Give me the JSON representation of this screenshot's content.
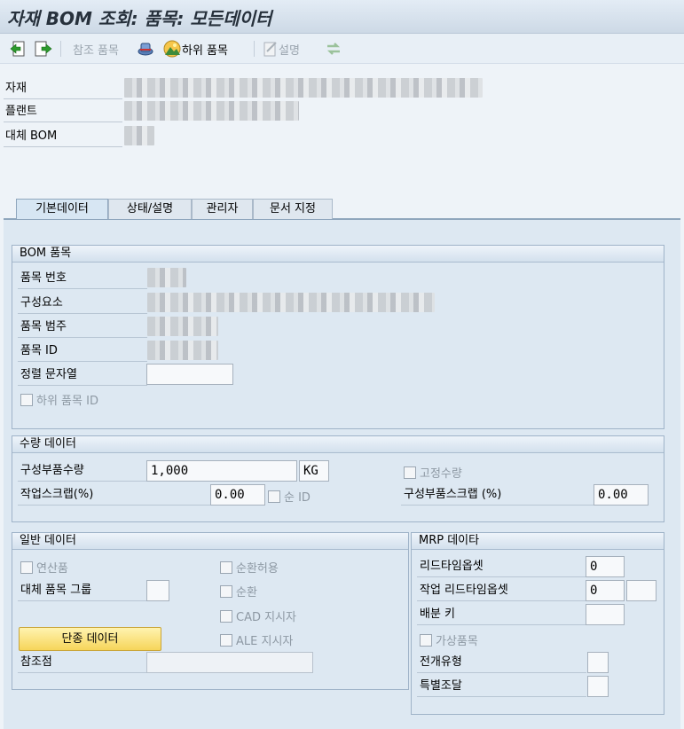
{
  "title": "자재 BOM 조회: 품목: 모든데이터",
  "toolbar": {
    "ref_item": "참조 품목",
    "sub_item": "하위 품목",
    "description": "설명"
  },
  "header": {
    "material_label": "자재",
    "plant_label": "플랜트",
    "alt_bom_label": "대체 BOM"
  },
  "tabs": [
    "기본데이터",
    "상태/설명",
    "관리자",
    "문서 지정"
  ],
  "bom_item": {
    "title": "BOM 품목",
    "item_no_label": "품목 번호",
    "component_label": "구성요소",
    "category_label": "품목 범주",
    "item_id_label": "품목 ID",
    "sort_string_label": "정렬 문자열",
    "sort_string_value": "",
    "sub_item_id_label": "하위 품목 ID"
  },
  "quantity": {
    "title": "수량 데이터",
    "component_qty_label": "구성부품수량",
    "component_qty_value": "1,000",
    "unit": "KG",
    "fixed_qty_label": "고정수량",
    "op_scrap_label": "작업스크랩(%)",
    "op_scrap_value": "0.00",
    "net_id_label": "순 ID",
    "comp_scrap_label": "구성부품스크랩 (%)",
    "comp_scrap_value": "0.00"
  },
  "general": {
    "title": "일반 데이터",
    "coproduct_label": "연산품",
    "alt_group_label": "대체 품목 그룹",
    "alt_group_value": "",
    "recursion_allowed_label": "순환허용",
    "recursion_label": "순환",
    "cad_label": "CAD 지시자",
    "ale_label": "ALE 지시자",
    "single_data_button": "단종 데이터",
    "ref_point_label": "참조점",
    "ref_point_value": ""
  },
  "mrp": {
    "title": "MRP 데이타",
    "lead_offset_label": "리드타임옵셋",
    "lead_offset_value": "0",
    "op_lead_offset_label": "작업 리드타임옵셋",
    "op_lead_offset_value": "0",
    "op_lead_offset_unit": "",
    "dist_key_label": "배분 키",
    "dist_key_value": "",
    "phantom_label": "가상품목",
    "explosion_type_label": "전개유형",
    "explosion_type_value": "",
    "special_proc_label": "특별조달",
    "special_proc_value": ""
  }
}
